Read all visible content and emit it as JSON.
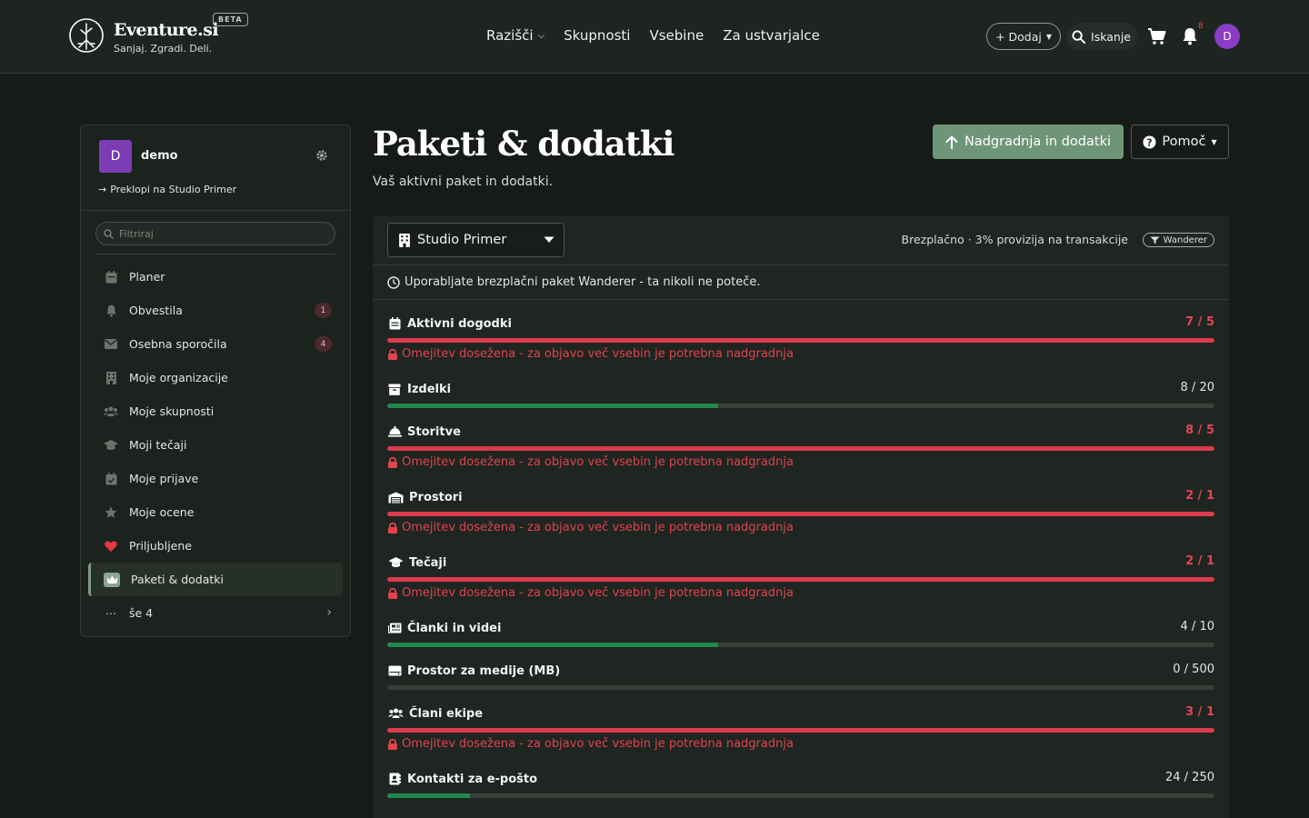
{
  "header": {
    "brand": "Eventure.si",
    "tagline": "Sanjaj. Zgradi. Deli.",
    "beta": "BETA",
    "nav": [
      {
        "label": "Razišči",
        "has_caret": true
      },
      {
        "label": "Skupnosti"
      },
      {
        "label": "Vsebine"
      },
      {
        "label": "Za ustvarjalce"
      }
    ],
    "add_label": "+ Dodaj",
    "search_label": "Iskanje",
    "notif_count": "8",
    "avatar_initial": "D"
  },
  "sidebar": {
    "avatar_initial": "D",
    "name": "demo",
    "switch_label": "Preklopi na Studio Primer",
    "filter_placeholder": "Filtriraj",
    "items": [
      {
        "label": "Planer",
        "icon": "calendar-icon"
      },
      {
        "label": "Obvestila",
        "icon": "bell-icon",
        "count": "1"
      },
      {
        "label": "Osebna sporočila",
        "icon": "envelope-icon",
        "count": "4"
      },
      {
        "label": "Moje organizacije",
        "icon": "building-icon"
      },
      {
        "label": "Moje skupnosti",
        "icon": "users-icon"
      },
      {
        "label": "Moji tečaji",
        "icon": "graduation-cap-icon"
      },
      {
        "label": "Moje prijave",
        "icon": "calendar-check-icon"
      },
      {
        "label": "Moje ocene",
        "icon": "star-icon"
      },
      {
        "label": "Priljubljene",
        "icon": "heart-icon"
      },
      {
        "label": "Paketi & dodatki",
        "icon": "crown-icon",
        "active": true
      },
      {
        "label": "še 4",
        "icon": "ellipsis-icon",
        "chevron": true
      }
    ]
  },
  "main": {
    "title": "Paketi & dodatki",
    "subtitle": "Vaš aktivni paket in dodatki.",
    "upgrade_label": "Nadgradnja in dodatki",
    "help_label": "Pomoč",
    "studio_name": "Studio Primer",
    "plan_info": "Brezplačno · 3% provizija na transakcije",
    "plan_badge": "Wanderer",
    "notice": "Uporabljate brezplačni paket Wanderer - ta nikoli ne poteče.",
    "warning_text": "Omejitev dosežena - za objavo več vsebin je potrebna nadgradnja",
    "limits": [
      {
        "label": "Aktivni dogodki",
        "icon": "calendar-icon",
        "used": 7,
        "max": 5,
        "count": "7 / 5",
        "fill": 1.0,
        "over": true
      },
      {
        "label": "Izdelki",
        "icon": "box-icon",
        "used": 8,
        "max": 20,
        "count": "8 / 20",
        "fill": 0.4,
        "over": false
      },
      {
        "label": "Storitve",
        "icon": "bell-service-icon",
        "used": 8,
        "max": 5,
        "count": "8 / 5",
        "fill": 1.0,
        "over": true
      },
      {
        "label": "Prostori",
        "icon": "warehouse-icon",
        "used": 2,
        "max": 1,
        "count": "2 / 1",
        "fill": 1.0,
        "over": true
      },
      {
        "label": "Tečaji",
        "icon": "graduation-cap-icon",
        "used": 2,
        "max": 1,
        "count": "2 / 1",
        "fill": 1.0,
        "over": true
      },
      {
        "label": "Članki in videi",
        "icon": "newspaper-icon",
        "used": 4,
        "max": 10,
        "count": "4 / 10",
        "fill": 0.4,
        "over": false
      },
      {
        "label": "Prostor za medije (MB)",
        "icon": "hdd-icon",
        "used": 0,
        "max": 500,
        "count": "0 / 500",
        "fill": 0.0,
        "over": false
      },
      {
        "label": "Člani ekipe",
        "icon": "users-icon",
        "used": 3,
        "max": 1,
        "count": "3 / 1",
        "fill": 1.0,
        "over": true
      },
      {
        "label": "Kontakti za e-pošto",
        "icon": "address-book-icon",
        "used": 24,
        "max": 250,
        "count": "24 / 250",
        "fill": 0.1,
        "over": false
      }
    ]
  }
}
